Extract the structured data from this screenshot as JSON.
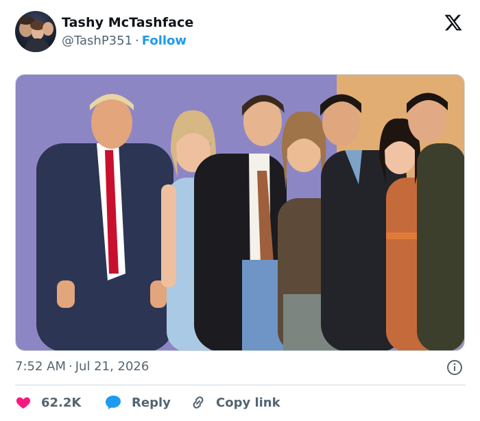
{
  "author": {
    "name": "Tashy McTashface",
    "handle": "@TashP351",
    "separator": "·",
    "follow_label": "Follow"
  },
  "brand": {
    "logo_icon": "x-logo-icon"
  },
  "post": {
    "photo_icon": "image",
    "time": "7:52 AM",
    "separator": "·",
    "date": "Jul 21, 2026"
  },
  "actions": {
    "like_count": "62.2K",
    "reply_label": "Reply",
    "copy_link_label": "Copy link"
  },
  "colors": {
    "accent": "#1d9bf0",
    "like": "#f91880",
    "text": "#0f1419",
    "muted": "#536471",
    "border": "#cfd9de"
  }
}
